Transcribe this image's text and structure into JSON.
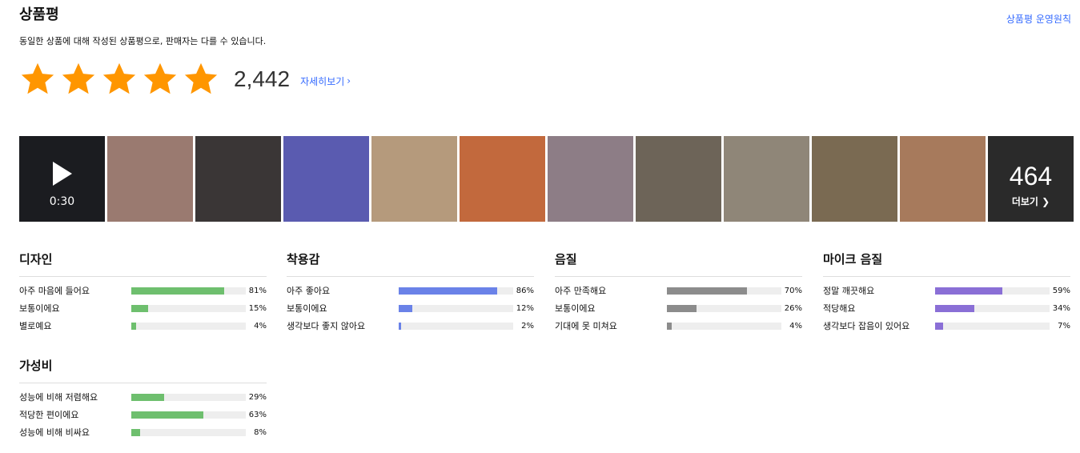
{
  "header": {
    "title": "상품평",
    "policy_link": "상품평 운영원칙",
    "notice": "동일한 상품에 대해 작성된 상품평으로, 판매자는 다를 수 있습니다."
  },
  "rating": {
    "stars": 5,
    "star_color": "#ff9600",
    "count": "2,442",
    "detail_link": "자세히보기",
    "detail_icon": "chevron-right-icon"
  },
  "photos": {
    "video_duration": "0:30",
    "more_count": "464",
    "more_label": "더보기 ❯",
    "items": [
      {
        "kind": "video",
        "bg": "#1b1c20"
      },
      {
        "kind": "photo",
        "bg": "#9a7a70"
      },
      {
        "kind": "photo",
        "bg": "#3a3636"
      },
      {
        "kind": "photo",
        "bg": "#5a5bb0"
      },
      {
        "kind": "photo",
        "bg": "#b59a7c"
      },
      {
        "kind": "photo",
        "bg": "#c2693d"
      },
      {
        "kind": "photo",
        "bg": "#8d7d86"
      },
      {
        "kind": "photo",
        "bg": "#6d6458"
      },
      {
        "kind": "photo",
        "bg": "#8f8678"
      },
      {
        "kind": "photo",
        "bg": "#7a6a52"
      },
      {
        "kind": "photo",
        "bg": "#a77a5c"
      }
    ]
  },
  "surveys": [
    {
      "title": "디자인",
      "color": "#6ebf6e",
      "options": [
        {
          "label": "아주 마음에 들어요",
          "pct": "81%",
          "value": 81
        },
        {
          "label": "보통이에요",
          "pct": "15%",
          "value": 15
        },
        {
          "label": "별로예요",
          "pct": "4%",
          "value": 4
        }
      ]
    },
    {
      "title": "착용감",
      "color": "#6a82e8",
      "options": [
        {
          "label": "아주 좋아요",
          "pct": "86%",
          "value": 86
        },
        {
          "label": "보통이에요",
          "pct": "12%",
          "value": 12
        },
        {
          "label": "생각보다 좋지 않아요",
          "pct": "2%",
          "value": 2
        }
      ]
    },
    {
      "title": "음질",
      "color": "#8c8c8c",
      "options": [
        {
          "label": "아주 만족해요",
          "pct": "70%",
          "value": 70
        },
        {
          "label": "보통이에요",
          "pct": "26%",
          "value": 26
        },
        {
          "label": "기대에 못 미쳐요",
          "pct": "4%",
          "value": 4
        }
      ]
    },
    {
      "title": "마이크 음질",
      "color": "#8a6fd6",
      "options": [
        {
          "label": "정말 깨끗해요",
          "pct": "59%",
          "value": 59
        },
        {
          "label": "적당해요",
          "pct": "34%",
          "value": 34
        },
        {
          "label": "생각보다 잡음이 있어요",
          "pct": "7%",
          "value": 7
        }
      ]
    },
    {
      "title": "가성비",
      "color": "#6ebf6e",
      "options": [
        {
          "label": "성능에 비해 저렴해요",
          "pct": "29%",
          "value": 29
        },
        {
          "label": "적당한 편이에요",
          "pct": "63%",
          "value": 63
        },
        {
          "label": "성능에 비해 비싸요",
          "pct": "8%",
          "value": 8
        }
      ]
    }
  ]
}
